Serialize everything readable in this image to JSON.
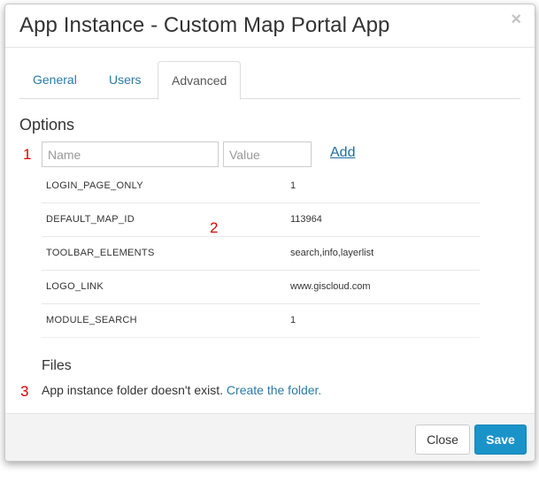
{
  "dialog": {
    "title": "App Instance - Custom Map Portal App",
    "close_icon": "×"
  },
  "tabs": [
    {
      "label": "General",
      "active": false
    },
    {
      "label": "Users",
      "active": false
    },
    {
      "label": "Advanced",
      "active": true
    }
  ],
  "options": {
    "heading": "Options",
    "name_placeholder": "Name",
    "value_placeholder": "Value",
    "add_label": "Add",
    "rows": [
      {
        "key": "LOGIN_PAGE_ONLY",
        "value": "1"
      },
      {
        "key": "DEFAULT_MAP_ID",
        "value": "113964"
      },
      {
        "key": "TOOLBAR_ELEMENTS",
        "value": "search,info,layerlist"
      },
      {
        "key": "LOGO_LINK",
        "value": "www.giscloud.com"
      },
      {
        "key": "MODULE_SEARCH",
        "value": "1"
      }
    ]
  },
  "files": {
    "heading": "Files",
    "message": "App instance folder doesn't exist.",
    "link_label": "Create the folder."
  },
  "markers": [
    "1",
    "2",
    "3"
  ],
  "footer": {
    "close_label": "Close",
    "save_label": "Save"
  },
  "colors": {
    "link": "#2a7aa8",
    "primary_button": "#1a93c9",
    "marker": "#e00000"
  }
}
